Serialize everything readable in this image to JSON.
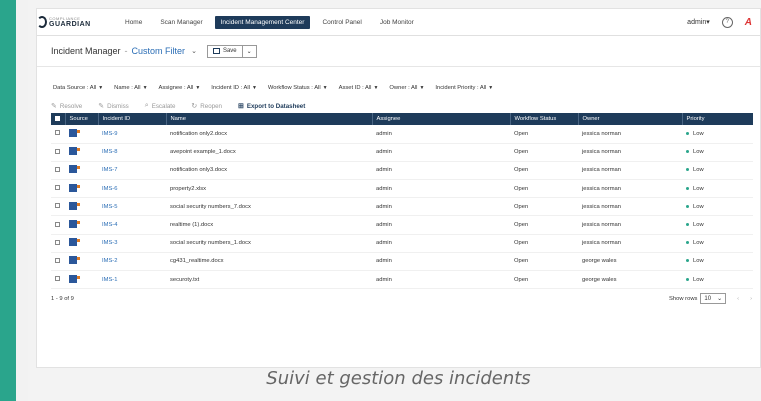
{
  "brand": {
    "name": "GUARDIAN",
    "sub": "COMPLIANCE"
  },
  "nav": [
    "Home",
    "Scan Manager",
    "Incident Management Center",
    "Control Panel",
    "Job Monitor"
  ],
  "nav_active": 2,
  "user": {
    "name": "admin",
    "caret": "▾"
  },
  "help_glyph": "?",
  "brand_letter": "A",
  "title": {
    "main": "Incident Manager",
    "sep": "-",
    "filter": "Custom Filter",
    "chevron": "⌄",
    "save": "Save",
    "save_drop": "⌄"
  },
  "filters": [
    "Data Source : All",
    "Name : All",
    "Assignee : All",
    "Incident ID : All",
    "Workflow Status : All",
    "Asset ID : All",
    "Owner : All",
    "Incident Priority : All"
  ],
  "filter_caret": "▼",
  "actions": [
    {
      "label": "Resolve",
      "icon": "✎",
      "enabled": false
    },
    {
      "label": "Dismiss",
      "icon": "✎",
      "enabled": false
    },
    {
      "label": "Escalate",
      "icon": "⌕",
      "enabled": false
    },
    {
      "label": "Reopen",
      "icon": "↻",
      "enabled": false
    },
    {
      "label": "Export to Datasheet",
      "icon": "⊞",
      "enabled": true
    }
  ],
  "table": {
    "columns": [
      "Source",
      "Incident ID",
      "Name",
      "Assignee",
      "Workflow Status",
      "Owner",
      "Priority"
    ],
    "rows": [
      {
        "id": "IMS-9",
        "name": "notification only2.docx",
        "assignee": "admin",
        "status": "Open",
        "owner": "jessica norman",
        "priority": "Low"
      },
      {
        "id": "IMS-8",
        "name": "avepoint example_1.docx",
        "assignee": "admin",
        "status": "Open",
        "owner": "jessica norman",
        "priority": "Low"
      },
      {
        "id": "IMS-7",
        "name": "notification only3.docx",
        "assignee": "admin",
        "status": "Open",
        "owner": "jessica norman",
        "priority": "Low"
      },
      {
        "id": "IMS-6",
        "name": "property2.xlsx",
        "assignee": "admin",
        "status": "Open",
        "owner": "jessica norman",
        "priority": "Low"
      },
      {
        "id": "IMS-5",
        "name": "social security numbers_7.docx",
        "assignee": "admin",
        "status": "Open",
        "owner": "jessica norman",
        "priority": "Low"
      },
      {
        "id": "IMS-4",
        "name": "realtime (1).docx",
        "assignee": "admin",
        "status": "Open",
        "owner": "jessica norman",
        "priority": "Low"
      },
      {
        "id": "IMS-3",
        "name": "social security numbers_1.docx",
        "assignee": "admin",
        "status": "Open",
        "owner": "jessica norman",
        "priority": "Low"
      },
      {
        "id": "IMS-2",
        "name": "cg431_realtime.docx",
        "assignee": "admin",
        "status": "Open",
        "owner": "george wales",
        "priority": "Low"
      },
      {
        "id": "IMS-1",
        "name": "securoty.txt",
        "assignee": "admin",
        "status": "Open",
        "owner": "george wales",
        "priority": "Low"
      }
    ]
  },
  "pager": {
    "range": "1 - 9 of 9",
    "show_rows_label": "Show rows",
    "rows_value": "10",
    "prev": "‹",
    "next": "›"
  },
  "caption": "Suivi et gestion des incidents",
  "colors": {
    "accent": "#2aa58c",
    "nav_active": "#1e3b5a",
    "link": "#2a6db5"
  }
}
